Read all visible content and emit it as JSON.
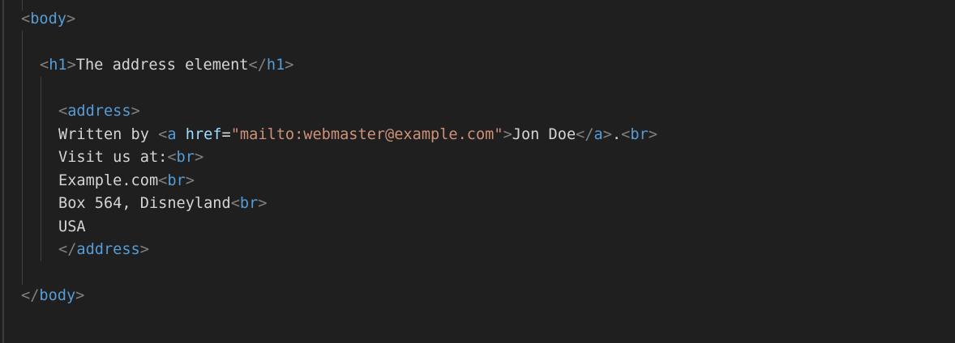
{
  "editor": {
    "lines": {
      "body_open": {
        "lt": "<",
        "name": "body",
        "gt": ">"
      },
      "h1": {
        "open_lt": "<",
        "open_name": "h1",
        "open_gt": ">",
        "text": "The address element",
        "close_lt": "</",
        "close_name": "h1",
        "close_gt": ">"
      },
      "address_open": {
        "lt": "<",
        "name": "address",
        "gt": ">"
      },
      "written_by": {
        "text": "Written by ",
        "a_lt": "<",
        "a_name": "a",
        "space": " ",
        "attr_name": "href",
        "eq": "=",
        "attr_value": "\"mailto:webmaster@example.com\"",
        "a_gt": ">",
        "link_text": "Jon Doe",
        "a_close_lt": "</",
        "a_close_name": "a",
        "a_close_gt": ">",
        "period": ".",
        "br_lt": "<",
        "br_name": "br",
        "br_gt": ">"
      },
      "visit": {
        "text": "Visit us at:",
        "br_lt": "<",
        "br_name": "br",
        "br_gt": ">"
      },
      "example": {
        "text": "Example.com",
        "br_lt": "<",
        "br_name": "br",
        "br_gt": ">"
      },
      "box": {
        "text": "Box 564, Disneyland",
        "br_lt": "<",
        "br_name": "br",
        "br_gt": ">"
      },
      "usa": {
        "text": "USA"
      },
      "address_close": {
        "lt": "</",
        "name": "address",
        "gt": ">"
      },
      "body_close": {
        "lt": "</",
        "name": "body",
        "gt": ">"
      }
    },
    "colors": {
      "background": "#1f1f1f",
      "tag_punct": "#808080",
      "tag_name": "#569cd6",
      "attr_name": "#9cdcfe",
      "attr_value": "#ce9178",
      "text": "#d4d4d4"
    }
  }
}
